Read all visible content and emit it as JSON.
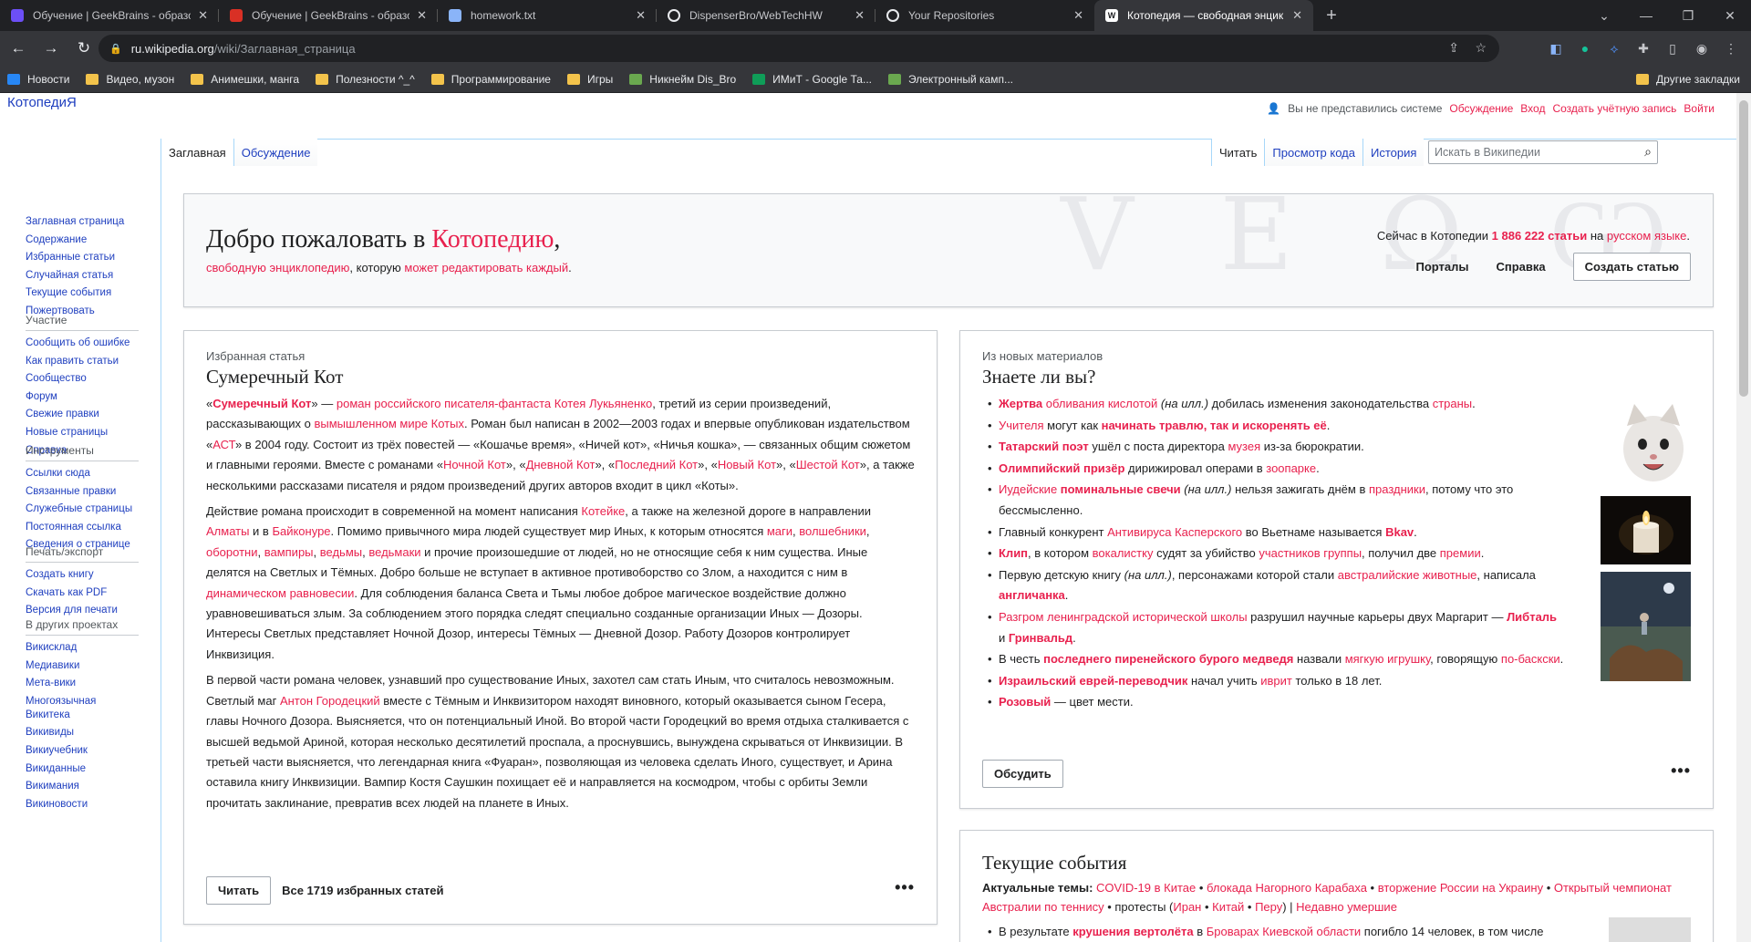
{
  "browser": {
    "tabs": [
      {
        "title": "Обучение | GeekBrains - образо",
        "favicon": "geekbrains-icon",
        "color": "#6c4ff6"
      },
      {
        "title": "Обучение | GeekBrains - образо",
        "favicon": "recording-icon",
        "color": "#d93025"
      },
      {
        "title": "homework.txt",
        "favicon": "file-icon",
        "color": "#8ab4f8"
      },
      {
        "title": "DispenserBro/WebTechHW",
        "favicon": "github-icon",
        "color": "#e8eaed"
      },
      {
        "title": "Your Repositories",
        "favicon": "github-icon",
        "color": "#e8eaed"
      },
      {
        "title": "Котопедия — свободная энцик",
        "favicon": "wikipedia-icon",
        "color": "#fff",
        "active": true
      }
    ],
    "url_host": "ru.wikipedia.org",
    "url_path": "/wiki/Заглавная_страница",
    "bookmarks": [
      {
        "label": "Новости",
        "type": "vk"
      },
      {
        "label": "Видео, музон",
        "type": "folder"
      },
      {
        "label": "Анимешки, манга",
        "type": "folder"
      },
      {
        "label": "Полезности ^_^",
        "type": "folder"
      },
      {
        "label": "Программирование",
        "type": "folder"
      },
      {
        "label": "Игры",
        "type": "folder"
      },
      {
        "label": "Никнейм Dis_Bro",
        "type": "site"
      },
      {
        "label": "ИМиТ - Google Та...",
        "type": "sheets"
      },
      {
        "label": "Электронный камп...",
        "type": "site"
      }
    ],
    "other_bookmarks": "Другие закладки"
  },
  "site": {
    "logo": "КотопедиЯ",
    "personal": {
      "not_logged": "Вы не представились системе",
      "discussion": "Обсуждение",
      "login": "Вход",
      "create_account": "Создать учётную запись",
      "logout": "Войти"
    },
    "tabs_left": [
      "Заглавная",
      "Обсуждение"
    ],
    "tabs_right": [
      "Читать",
      "Просмотр кода",
      "История"
    ],
    "search_placeholder": "Искать в Википедии"
  },
  "sidebar": {
    "nav": [
      "Заглавная страница",
      "Содержание",
      "Избранные статьи",
      "Случайная статья",
      "Текущие события",
      "Пожертвовать"
    ],
    "participation": {
      "title": "Участие",
      "items": [
        "Сообщить об ошибке",
        "Как править статьи",
        "Сообщество",
        "Форум",
        "Свежие правки",
        "Новые страницы",
        "Справка"
      ]
    },
    "tools": {
      "title": "Инструменты",
      "items": [
        "Ссылки сюда",
        "Связанные правки",
        "Служебные страницы",
        "Постоянная ссылка",
        "Сведения о странице"
      ]
    },
    "print": {
      "title": "Печать/экспорт",
      "items": [
        "Создать книгу",
        "Скачать как PDF",
        "Версия для печати"
      ]
    },
    "projects": {
      "title": "В других проектах",
      "items": [
        "Викисклад",
        "Медиавики",
        "Мета-вики",
        "Многоязычная Викитека",
        "Викивиды",
        "Викиучебник",
        "Викиданные",
        "Викимания",
        "Викиновости"
      ]
    }
  },
  "welcome": {
    "title_pre": "Добро пожаловать в ",
    "title_link": "Котопедию",
    "title_post": ",",
    "sub_link1": "свободную энциклопедию",
    "sub_mid": ", которую ",
    "sub_link2": "может редактировать каждый",
    "stat_pre": "Сейчас в Котопедии ",
    "stat_count": "1 886 222 статьи",
    "stat_mid": " на ",
    "stat_lang": "русском языке",
    "portals": "Порталы",
    "help": "Справка",
    "create": "Создать статью"
  },
  "featured": {
    "label": "Избранная статья",
    "title": "Сумеречный Кот",
    "read": "Читать",
    "all": "Все 1719 избранных статей"
  },
  "dyk": {
    "label": "Из новых материалов",
    "title": "Знаете ли вы?",
    "discuss": "Обсудить"
  },
  "current": {
    "title": "Текущие события",
    "topics_label": "Актуальные темы:"
  }
}
